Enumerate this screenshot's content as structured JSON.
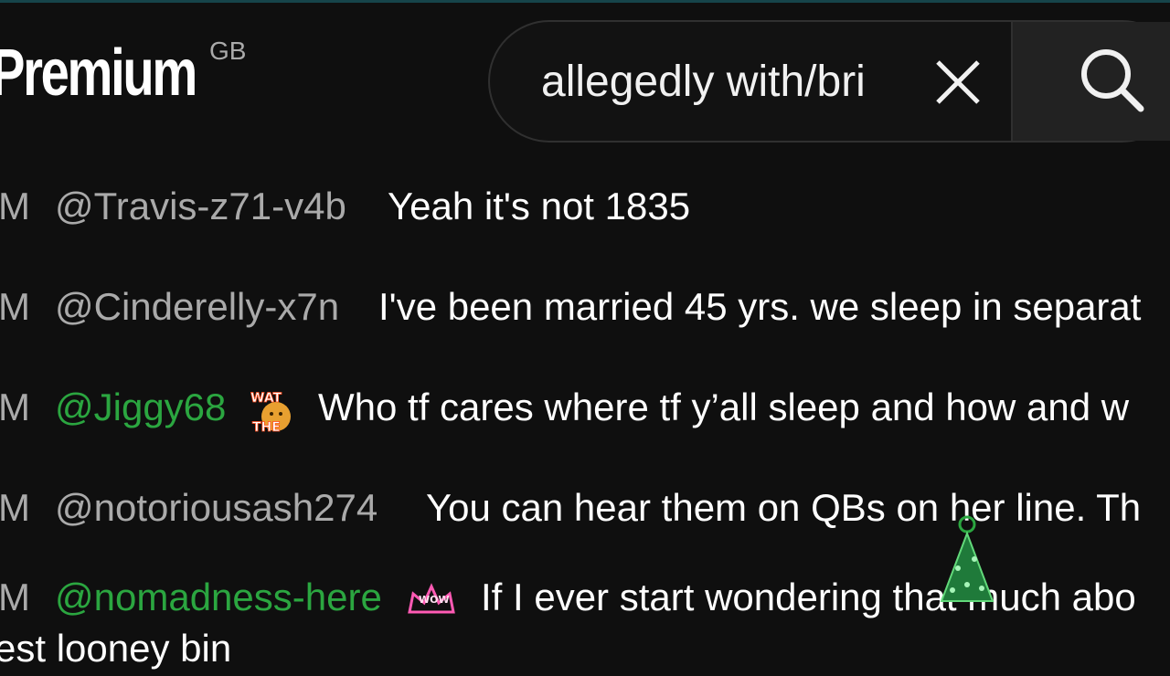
{
  "header": {
    "logo_text": "Premium",
    "region_code": "GB"
  },
  "search": {
    "query": "allegedly with/bri"
  },
  "chat": {
    "messages": [
      {
        "timestamp": "M",
        "author": "@Travis-z71-v4b",
        "text": "Yeah it's not 1835",
        "member": false
      },
      {
        "timestamp": "M",
        "author": "@Cinderelly-x7n",
        "text": "I've been married 45 yrs. we sleep in separat",
        "member": false
      },
      {
        "timestamp": "M",
        "author": "@Jiggy68",
        "text": "Who tf cares where tf y’all sleep and how and w",
        "member": true,
        "badge": "WAT THE"
      },
      {
        "timestamp": "M",
        "author": "@notoriousash274",
        "text": "You can hear them on QBs on her line. Th",
        "member": false
      },
      {
        "timestamp": "M",
        "author": "@nomadness-here",
        "text": "If I ever start wondering that much abo",
        "member": true,
        "badge": "WOW"
      }
    ],
    "overflow_text": "est looney bin"
  },
  "colors": {
    "background": "#0f0f0f",
    "member_name": "#2ba640",
    "author_name": "#aaaaaa",
    "text": "#ffffff"
  }
}
